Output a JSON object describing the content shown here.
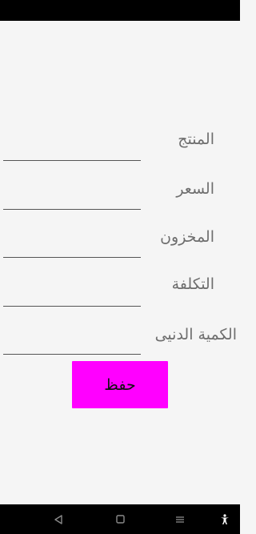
{
  "form": {
    "fields": [
      {
        "label": "المنتج",
        "value": ""
      },
      {
        "label": "السعر",
        "value": ""
      },
      {
        "label": "المخزون",
        "value": ""
      },
      {
        "label": "التكلفة",
        "value": ""
      },
      {
        "label": "الكمية الدنيى",
        "value": ""
      }
    ],
    "save_label": "حفظ"
  },
  "colors": {
    "save_button": "#ff00ff",
    "background": "#f5f5f5",
    "system_bars": "#000000"
  },
  "nav": {
    "icons": [
      "back-icon",
      "home-icon",
      "recents-icon",
      "accessibility-icon"
    ]
  }
}
